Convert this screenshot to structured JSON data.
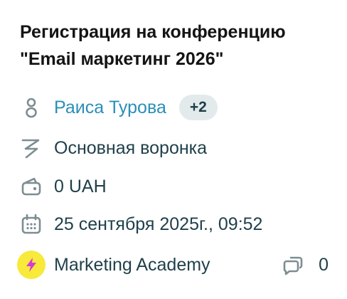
{
  "deal": {
    "title_line1": "Регистрация на конференцию",
    "title_line2": "\"Email маркетинг 2026\"",
    "contact_name": "Раиса Турова",
    "contacts_more": "+2",
    "pipeline": "Основная воронка",
    "amount": "0 UAH",
    "datetime": "25 сентября 2025г., 09:52",
    "company": "Marketing Academy",
    "comments_count": "0"
  },
  "colors": {
    "text": "#1f3f4a",
    "link": "#2a8fb8",
    "badge_bg": "#e3eaec",
    "company_logo_bg": "#f7ea3a",
    "company_logo_bolt": "#d63bd4"
  },
  "icons": {
    "contact": "person-icon",
    "pipeline": "funnel-bolt-icon",
    "amount": "wallet-icon",
    "date": "calendar-icon",
    "company": "lightning-icon",
    "comments": "chat-bubbles-icon"
  }
}
